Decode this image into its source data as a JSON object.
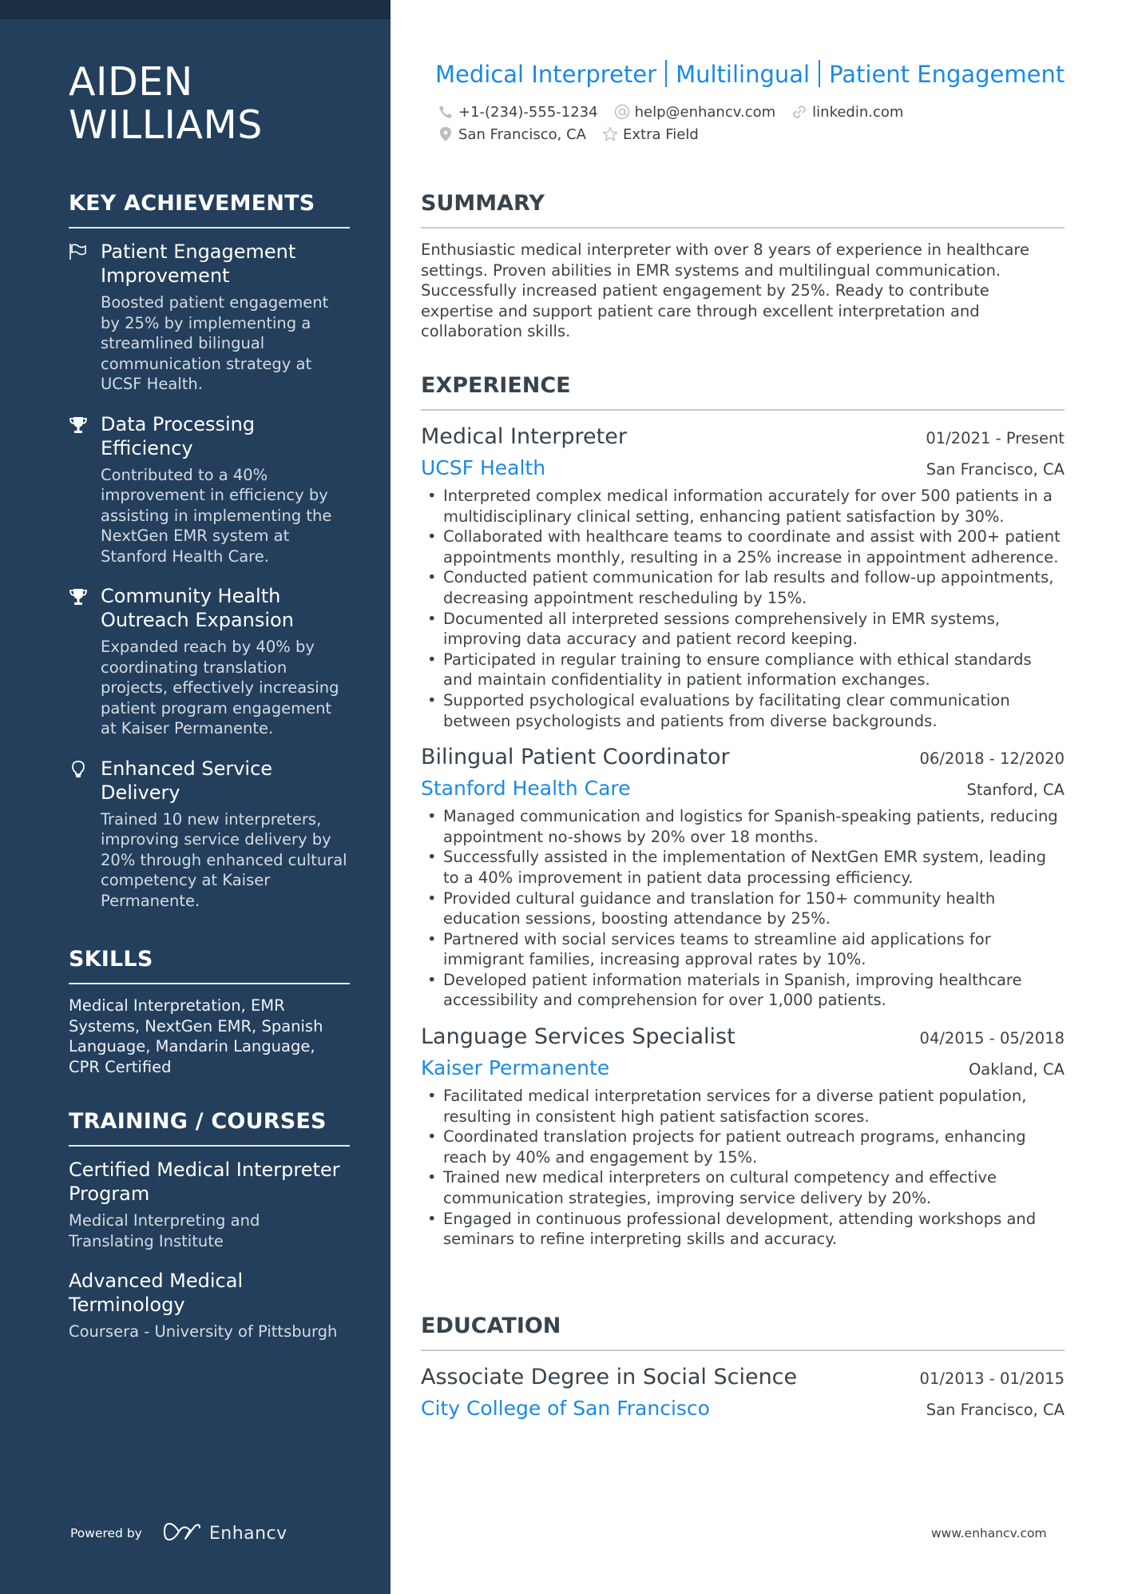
{
  "person": {
    "first_name": "AIDEN",
    "last_name": "WILLIAMS"
  },
  "header": {
    "headline_parts": [
      "Medical Interpreter",
      "Multilingual",
      "Patient Engagement"
    ],
    "contacts": {
      "phone": {
        "icon": "phone-icon",
        "value": "+1-(234)-555-1234"
      },
      "email": {
        "icon": "at-icon",
        "value": "help@enhancv.com"
      },
      "link": {
        "icon": "link-icon",
        "value": "linkedin.com"
      },
      "location": {
        "icon": "location-pin-icon",
        "value": "San Francisco, CA"
      },
      "extra": {
        "icon": "star-icon",
        "value": "Extra Field"
      }
    }
  },
  "sidebar": {
    "key_achievements": {
      "heading": "KEY ACHIEVEMENTS",
      "items": [
        {
          "icon": "flag-icon",
          "title": "Patient Engagement Improvement",
          "description": "Boosted patient engagement by 25% by implementing a streamlined bilingual communication strategy at UCSF Health."
        },
        {
          "icon": "trophy-icon",
          "title": "Data Processing Efficiency",
          "description": "Contributed to a 40% improvement in efficiency by assisting in implementing the NextGen EMR system at Stanford Health Care."
        },
        {
          "icon": "trophy-icon",
          "title": "Community Health Outreach Expansion",
          "description": "Expanded reach by 40% by coordinating translation projects, effectively increasing patient program engagement at Kaiser Permanente."
        },
        {
          "icon": "lightbulb-icon",
          "title": "Enhanced Service Delivery",
          "description": "Trained 10 new interpreters, improving service delivery by 20% through enhanced cultural competency at Kaiser Permanente."
        }
      ]
    },
    "skills": {
      "heading": "SKILLS",
      "text": "Medical Interpretation, EMR Systems, NextGen EMR, Spanish Language, Mandarin Language, CPR Certified"
    },
    "training": {
      "heading": "TRAINING / COURSES",
      "items": [
        {
          "title": "Certified Medical Interpreter Program",
          "organization": "Medical Interpreting and Translating Institute"
        },
        {
          "title": "Advanced Medical Terminology",
          "organization": "Coursera - University of Pittsburgh"
        }
      ]
    },
    "footer": {
      "powered_by": "Powered by",
      "brand": "Enhancv"
    }
  },
  "main": {
    "summary": {
      "heading": "SUMMARY",
      "text": "Enthusiastic medical interpreter with over 8 years of experience in healthcare settings. Proven abilities in EMR systems and multilingual communication. Successfully increased patient engagement by 25%. Ready to contribute expertise and support patient care through excellent interpretation and collaboration skills."
    },
    "experience": {
      "heading": "EXPERIENCE",
      "jobs": [
        {
          "title": "Medical Interpreter",
          "dates": "01/2021 - Present",
          "company": "UCSF Health",
          "location": "San Francisco, CA",
          "bullets": [
            "Interpreted complex medical information accurately for over 500 patients in a multidisciplinary clinical setting, enhancing patient satisfaction by 30%.",
            "Collaborated with healthcare teams to coordinate and assist with 200+ patient appointments monthly, resulting in a 25% increase in appointment adherence.",
            "Conducted patient communication for lab results and follow-up appointments, decreasing appointment rescheduling by 15%.",
            "Documented all interpreted sessions comprehensively in EMR systems, improving data accuracy and patient record keeping.",
            "Participated in regular training to ensure compliance with ethical standards and maintain confidentiality in patient information exchanges.",
            "Supported psychological evaluations by facilitating clear communication between psychologists and patients from diverse backgrounds."
          ]
        },
        {
          "title": "Bilingual Patient Coordinator",
          "dates": "06/2018 - 12/2020",
          "company": "Stanford Health Care",
          "location": "Stanford, CA",
          "bullets": [
            "Managed communication and logistics for Spanish-speaking patients, reducing appointment no-shows by 20% over 18 months.",
            "Successfully assisted in the implementation of NextGen EMR system, leading to a 40% improvement in patient data processing efficiency.",
            "Provided cultural guidance and translation for 150+ community health education sessions, boosting attendance by 25%.",
            "Partnered with social services teams to streamline aid applications for immigrant families, increasing approval rates by 10%.",
            "Developed patient information materials in Spanish, improving healthcare accessibility and comprehension for over 1,000 patients."
          ]
        },
        {
          "title": "Language Services Specialist",
          "dates": "04/2015 - 05/2018",
          "company": "Kaiser Permanente",
          "location": "Oakland, CA",
          "bullets": [
            "Facilitated medical interpretation services for a diverse patient population, resulting in consistent high patient satisfaction scores.",
            "Coordinated translation projects for patient outreach programs, enhancing reach by 40% and engagement by 15%.",
            "Trained new medical interpreters on cultural competency and effective communication strategies, improving service delivery by 20%.",
            "Engaged in continuous professional development, attending workshops and seminars to refine interpreting skills and accuracy."
          ]
        }
      ]
    },
    "education": {
      "heading": "EDUCATION",
      "items": [
        {
          "degree": "Associate Degree in Social Science",
          "dates": "01/2013 - 01/2015",
          "school": "City College of San Francisco",
          "location": "San Francisco, CA"
        }
      ]
    },
    "footer_url": "www.enhancv.com"
  },
  "colors": {
    "sidebar_bg": "#233f5c",
    "sidebar_topbar": "#1b2f45",
    "accent": "#1a8ae6",
    "body_text": "#3b4348"
  }
}
